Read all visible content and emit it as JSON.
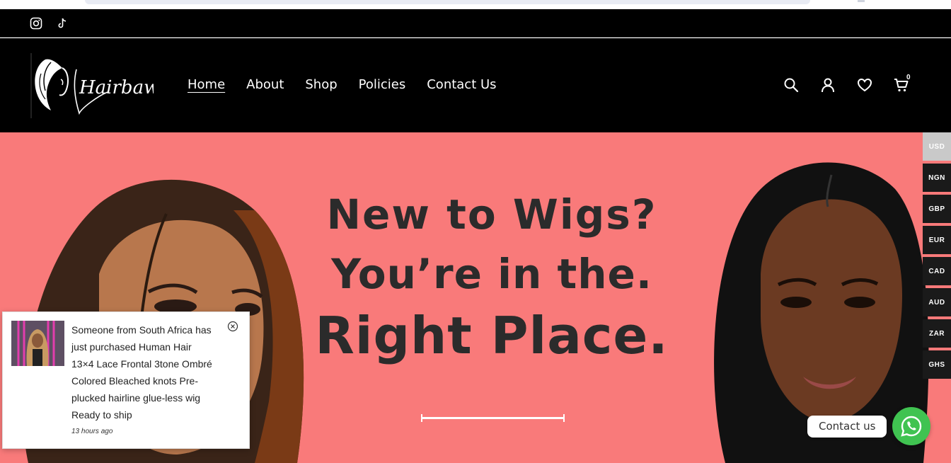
{
  "header": {
    "logo_text": "Hairbaws",
    "nav": [
      {
        "label": "Home",
        "active": true
      },
      {
        "label": "About"
      },
      {
        "label": "Shop"
      },
      {
        "label": "Policies"
      },
      {
        "label": "Contact Us"
      }
    ],
    "cart_count": "0"
  },
  "social": [
    "instagram-icon",
    "tiktok-icon"
  ],
  "hero": {
    "line1": "New to Wigs?",
    "line2": "You’re in the.",
    "line3": "Right Place.",
    "background_color": "#f97a7a"
  },
  "currency": {
    "options": [
      "USD",
      "NGN",
      "GBP",
      "EUR",
      "CAD",
      "AUD",
      "ZAR",
      "GHS"
    ],
    "selected": "USD"
  },
  "popup": {
    "message": "Someone from South Africa has just purchased Human Hair 13×4 Lace Frontal 3tone Ombré Colored Bleached knots Pre-plucked hairline glue-less wig Ready to ship",
    "time": "13 hours ago"
  },
  "contact": {
    "label": "Contact us",
    "accent": "#40c351"
  }
}
